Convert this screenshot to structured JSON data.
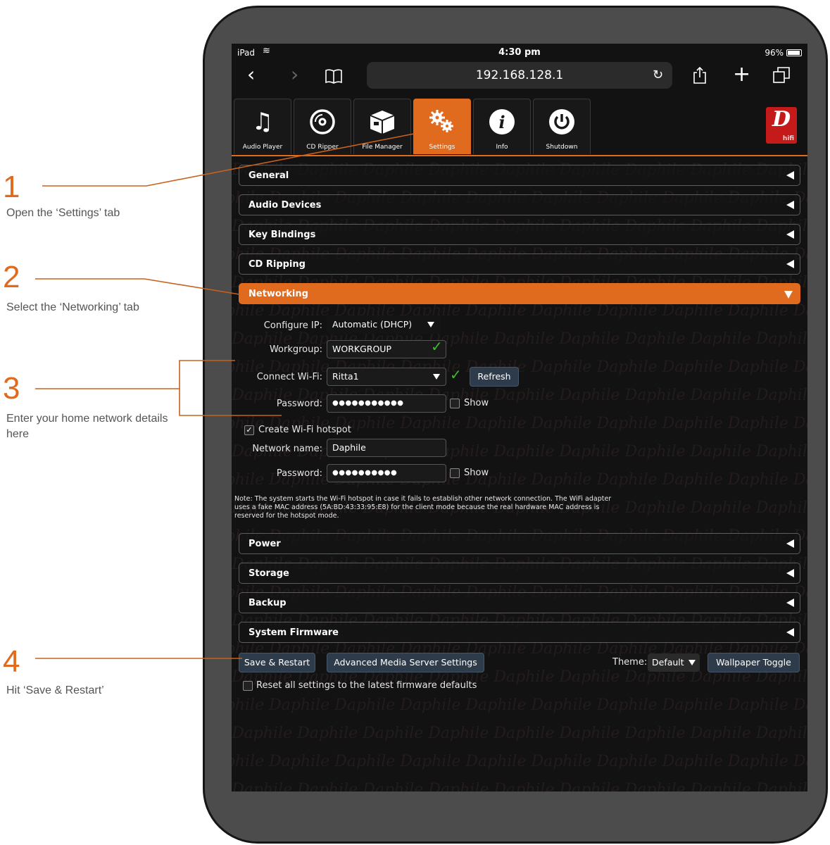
{
  "annotations": [
    {
      "num": "1",
      "text": "Open the ‘Settings’ tab"
    },
    {
      "num": "2",
      "text": "Select the ‘Networking’ tab"
    },
    {
      "num": "3",
      "text": "Enter your home network details here"
    },
    {
      "num": "4",
      "text": "Hit ‘Save & Restart’"
    }
  ],
  "status": {
    "device": "iPad",
    "time": "4:30 pm",
    "battery": "96%"
  },
  "browser": {
    "url": "192.168.128.1"
  },
  "app_tabs": [
    {
      "label": "Audio Player",
      "icon": "music-note-icon"
    },
    {
      "label": "CD Ripper",
      "icon": "cd-icon"
    },
    {
      "label": "File Manager",
      "icon": "box-icon"
    },
    {
      "label": "Settings",
      "icon": "gears-icon"
    },
    {
      "label": "Info",
      "icon": "info-icon"
    },
    {
      "label": "Shutdown",
      "icon": "power-icon"
    }
  ],
  "logo": {
    "letter": "D",
    "sub": "hifi"
  },
  "watermark": "Daphile",
  "sections": {
    "general": "General",
    "audio_devices": "Audio Devices",
    "key_bindings": "Key Bindings",
    "cd_ripping": "CD Ripping",
    "networking": "Networking",
    "power": "Power",
    "storage": "Storage",
    "backup": "Backup",
    "system_firmware": "System Firmware"
  },
  "networking": {
    "configure_ip_label": "Configure IP:",
    "configure_ip_value": "Automatic (DHCP)",
    "workgroup_label": "Workgroup:",
    "workgroup_value": "WORKGROUP",
    "connect_wifi_label": "Connect Wi-Fi:",
    "connect_wifi_value": "Ritta1",
    "refresh_label": "Refresh",
    "password_label": "Password:",
    "password_value": "●●●●●●●●●●●",
    "show_label": "Show",
    "hotspot_label": "Create Wi-Fi hotspot",
    "network_name_label": "Network name:",
    "network_name_value": "Daphile",
    "hotspot_password_label": "Password:",
    "hotspot_password_value": "●●●●●●●●●●",
    "hotspot_show_label": "Show",
    "note": "Note: The system starts the Wi-Fi hotspot in case it fails to establish other network connection. The WiFi adapter uses a fake MAC address (5A:BD:43:33:95:E8) for the client mode because the real hardware MAC address is reserved for the hotspot mode."
  },
  "footer": {
    "save_restart": "Save & Restart",
    "advanced": "Advanced Media Server Settings",
    "theme_label": "Theme:",
    "theme_value": "Default",
    "wallpaper": "Wallpaper Toggle",
    "reset_label": "Reset all settings to the latest firmware defaults"
  },
  "colors": {
    "accent": "#e06a1e",
    "background": "#121212",
    "check": "#3fbb2a"
  }
}
